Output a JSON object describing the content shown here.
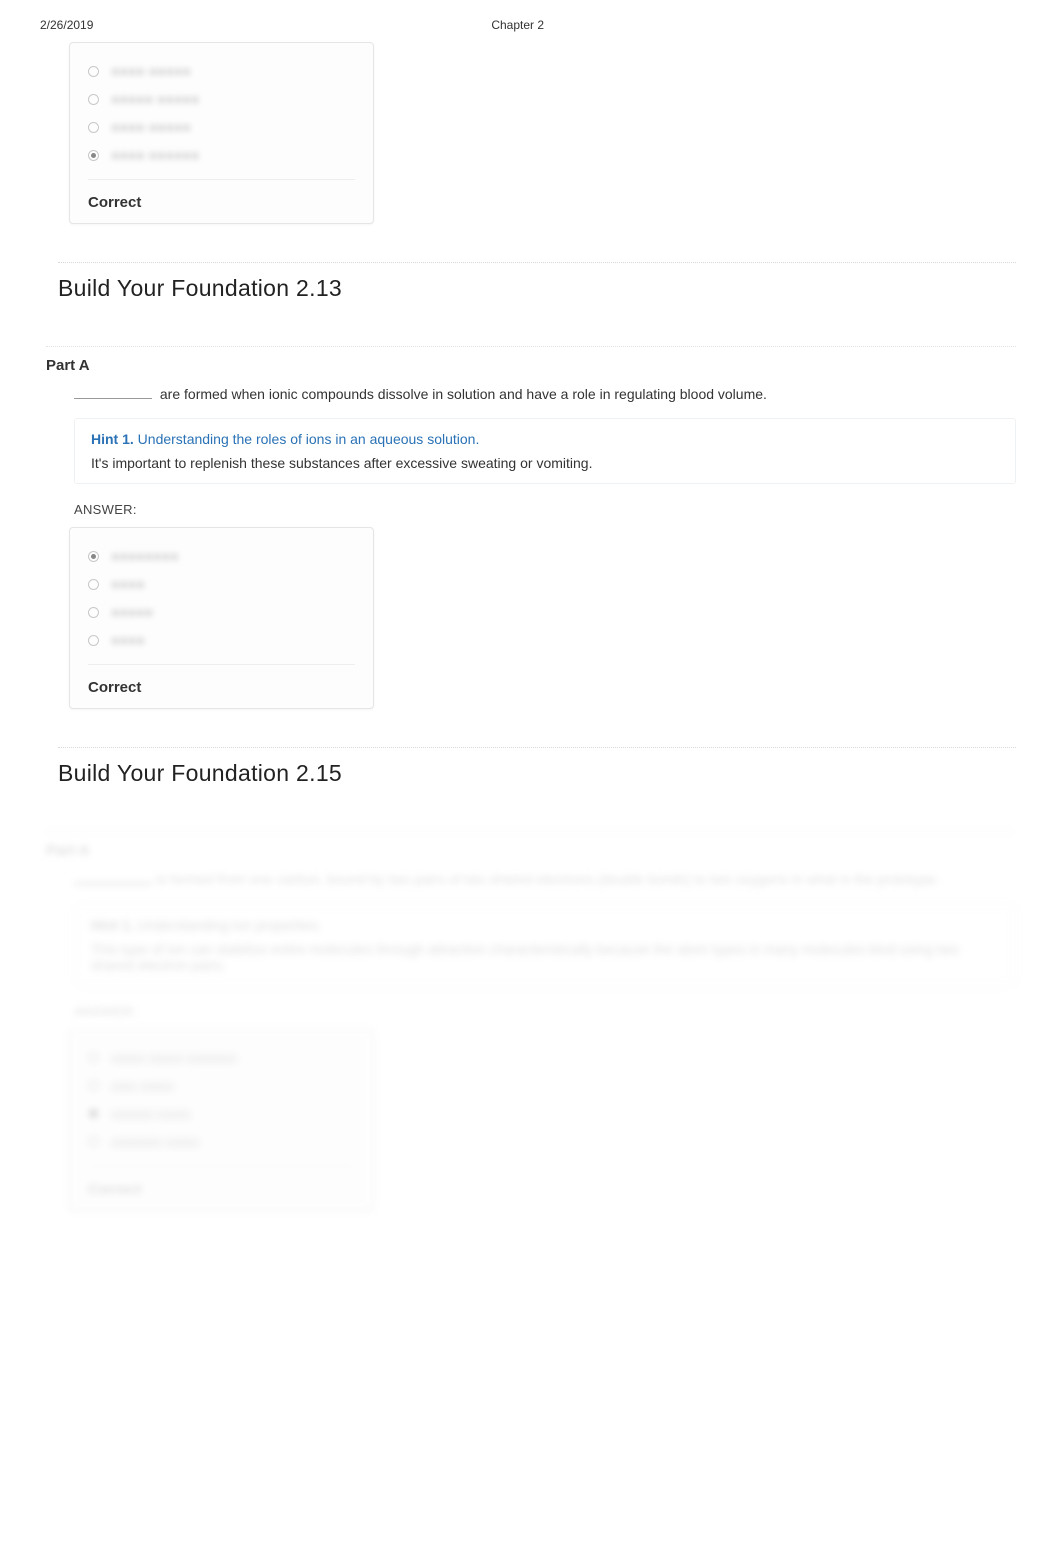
{
  "meta": {
    "date": "2/26/2019",
    "chapter": "Chapter 2"
  },
  "top_panel": {
    "options": [
      {
        "label": "■■■■ ■■■■■",
        "selected": false
      },
      {
        "label": "■■■■■ ■■■■■",
        "selected": false
      },
      {
        "label": "■■■■ ■■■■■",
        "selected": false
      },
      {
        "label": "■■■■ ■■■■■■",
        "selected": true
      }
    ],
    "result": "Correct"
  },
  "q13": {
    "title": "Build Your Foundation 2.13",
    "part": "Part A",
    "question_suffix": " are formed when ionic compounds dissolve in solution and have a role in regulating blood volume.",
    "hint_label": "Hint 1.",
    "hint_title": "Understanding the roles of ions in an aqueous solution.",
    "hint_body": "It's important to replenish these substances after excessive sweating or vomiting.",
    "answer_label": "ANSWER:",
    "options": [
      {
        "label": "■■■■■■■■",
        "selected": true
      },
      {
        "label": "■■■■",
        "selected": false
      },
      {
        "label": "■■■■■",
        "selected": false
      },
      {
        "label": "■■■■",
        "selected": false
      }
    ],
    "result": "Correct"
  },
  "q15": {
    "title": "Build Your Foundation 2.15",
    "part": "Part A",
    "question_prefix": "____________ ",
    "question_suffix": "is formed from one carbon, bound by two pairs of two shared electrons (double bonds) to two oxygens in what is the prototype.",
    "hint_label": "Hint 1.",
    "hint_title": "Understanding ion properties.",
    "hint_body": "This type of ion can stabilize entire molecules through attraction characteristically because the atom types in many molecules bind using two shared electron pairs.",
    "answer_label": "ANSWER:",
    "options": [
      {
        "label": "■■■■ ■■■■ ■■■■■■",
        "selected": false
      },
      {
        "label": "■■■ ■■■■",
        "selected": false
      },
      {
        "label": "■■■■■ ■■■■",
        "selected": true
      },
      {
        "label": "■■■■■■ ■■■■",
        "selected": false
      }
    ],
    "result": "Correct"
  }
}
